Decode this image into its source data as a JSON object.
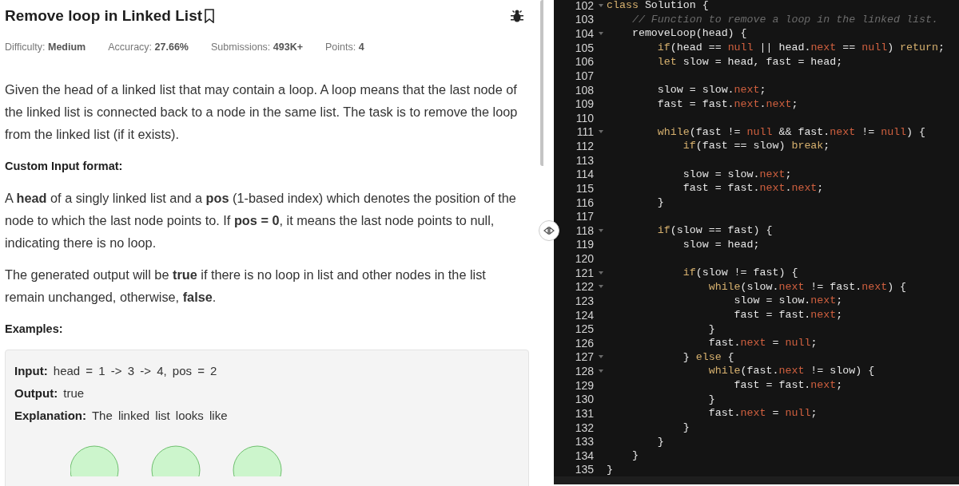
{
  "problem": {
    "title": "Remove loop in Linked List",
    "meta": [
      {
        "label": "Difficulty:",
        "value": "Medium"
      },
      {
        "label": "Accuracy:",
        "value": "27.66%"
      },
      {
        "label": "Submissions:",
        "value": "493K+"
      },
      {
        "label": "Points:",
        "value": "4"
      }
    ],
    "body": [
      {
        "kind": "paragraph",
        "text": "Given the head of a linked list that may contain a loop.  A loop means that the last node of the linked list is connected back to a node in the same list. The task is to remove the loop from the linked list (if it exists)."
      },
      {
        "kind": "heading",
        "text": "Custom Input format:"
      },
      {
        "kind": "paragraph",
        "text": "A **head** of a singly linked list and a **pos** (1-based index) which denotes the position of the node to which the last node points to. If **pos = 0**, it means the last node points to null, indicating there is no loop."
      },
      {
        "kind": "paragraph",
        "text": "The generated output will be **true** if there is no loop in list and other nodes in the list remain unchanged, otherwise, **false**."
      },
      {
        "kind": "heading",
        "text": "Examples:"
      }
    ],
    "example": [
      {
        "label": "Input:",
        "value": "head = 1 -> 3 -> 4, pos = 2"
      },
      {
        "label": "Output:",
        "value": "true"
      },
      {
        "label": "Explanation:",
        "value": "The linked list looks like"
      }
    ]
  },
  "editor": {
    "lines": [
      {
        "number": "102",
        "fold": true,
        "tokens": [
          {
            "kind": "kw",
            "text": "class"
          },
          {
            "kind": "plain",
            "text": " Solution {"
          }
        ]
      },
      {
        "number": "103",
        "fold": false,
        "tokens": [
          {
            "kind": "comment",
            "text": "    // Function to remove a loop in the linked list."
          }
        ]
      },
      {
        "number": "104",
        "fold": true,
        "tokens": [
          {
            "kind": "plain",
            "text": "    removeLoop(head) {"
          }
        ]
      },
      {
        "number": "105",
        "fold": false,
        "tokens": [
          {
            "kind": "kw",
            "text": "        if"
          },
          {
            "kind": "plain",
            "text": "(head == "
          },
          {
            "kind": "lit",
            "text": "null"
          },
          {
            "kind": "plain",
            "text": " || head."
          },
          {
            "kind": "lit",
            "text": "next"
          },
          {
            "kind": "plain",
            "text": " == "
          },
          {
            "kind": "lit",
            "text": "null"
          },
          {
            "kind": "plain",
            "text": ") "
          },
          {
            "kind": "kw",
            "text": "return"
          },
          {
            "kind": "plain",
            "text": ";"
          }
        ]
      },
      {
        "number": "106",
        "fold": false,
        "tokens": [
          {
            "kind": "kw",
            "text": "        let"
          },
          {
            "kind": "plain",
            "text": " slow = head, fast = head;"
          }
        ]
      },
      {
        "number": "107",
        "fold": false
      },
      {
        "number": "108",
        "fold": false,
        "tokens": [
          {
            "kind": "plain",
            "text": "        slow = slow."
          },
          {
            "kind": "lit",
            "text": "next"
          },
          {
            "kind": "plain",
            "text": ";"
          }
        ]
      },
      {
        "number": "109",
        "fold": false,
        "tokens": [
          {
            "kind": "plain",
            "text": "        fast = fast."
          },
          {
            "kind": "lit",
            "text": "next"
          },
          {
            "kind": "plain",
            "text": "."
          },
          {
            "kind": "lit",
            "text": "next"
          },
          {
            "kind": "plain",
            "text": ";"
          }
        ]
      },
      {
        "number": "110",
        "fold": false
      },
      {
        "number": "111",
        "fold": true,
        "tokens": [
          {
            "kind": "kw",
            "text": "        while"
          },
          {
            "kind": "plain",
            "text": "(fast != "
          },
          {
            "kind": "lit",
            "text": "null"
          },
          {
            "kind": "plain",
            "text": " && fast."
          },
          {
            "kind": "lit",
            "text": "next"
          },
          {
            "kind": "plain",
            "text": " != "
          },
          {
            "kind": "lit",
            "text": "null"
          },
          {
            "kind": "plain",
            "text": ") {"
          }
        ]
      },
      {
        "number": "112",
        "fold": false,
        "tokens": [
          {
            "kind": "kw",
            "text": "            if"
          },
          {
            "kind": "plain",
            "text": "(fast == slow) "
          },
          {
            "kind": "kw",
            "text": "break"
          },
          {
            "kind": "plain",
            "text": ";"
          }
        ]
      },
      {
        "number": "113",
        "fold": false
      },
      {
        "number": "114",
        "fold": false,
        "tokens": [
          {
            "kind": "plain",
            "text": "            slow = slow."
          },
          {
            "kind": "lit",
            "text": "next"
          },
          {
            "kind": "plain",
            "text": ";"
          }
        ]
      },
      {
        "number": "115",
        "fold": false,
        "tokens": [
          {
            "kind": "plain",
            "text": "            fast = fast."
          },
          {
            "kind": "lit",
            "text": "next"
          },
          {
            "kind": "plain",
            "text": "."
          },
          {
            "kind": "lit",
            "text": "next"
          },
          {
            "kind": "plain",
            "text": ";"
          }
        ]
      },
      {
        "number": "116",
        "fold": false,
        "tokens": [
          {
            "kind": "plain",
            "text": "        }"
          }
        ]
      },
      {
        "number": "117",
        "fold": false
      },
      {
        "number": "118",
        "fold": true,
        "tokens": [
          {
            "kind": "kw",
            "text": "        if"
          },
          {
            "kind": "plain",
            "text": "(slow == fast) {"
          }
        ]
      },
      {
        "number": "119",
        "fold": false,
        "tokens": [
          {
            "kind": "plain",
            "text": "            slow = head;"
          }
        ]
      },
      {
        "number": "120",
        "fold": false
      },
      {
        "number": "121",
        "fold": true,
        "tokens": [
          {
            "kind": "kw",
            "text": "            if"
          },
          {
            "kind": "plain",
            "text": "(slow != fast) {"
          }
        ]
      },
      {
        "number": "122",
        "fold": true,
        "tokens": [
          {
            "kind": "kw",
            "text": "                while"
          },
          {
            "kind": "plain",
            "text": "(slow."
          },
          {
            "kind": "lit",
            "text": "next"
          },
          {
            "kind": "plain",
            "text": " != fast."
          },
          {
            "kind": "lit",
            "text": "next"
          },
          {
            "kind": "plain",
            "text": ") {"
          }
        ]
      },
      {
        "number": "123",
        "fold": false,
        "tokens": [
          {
            "kind": "plain",
            "text": "                    slow = slow."
          },
          {
            "kind": "lit",
            "text": "next"
          },
          {
            "kind": "plain",
            "text": ";"
          }
        ]
      },
      {
        "number": "124",
        "fold": false,
        "tokens": [
          {
            "kind": "plain",
            "text": "                    fast = fast."
          },
          {
            "kind": "lit",
            "text": "next"
          },
          {
            "kind": "plain",
            "text": ";"
          }
        ]
      },
      {
        "number": "125",
        "fold": false,
        "tokens": [
          {
            "kind": "plain",
            "text": "                }"
          }
        ]
      },
      {
        "number": "126",
        "fold": false,
        "tokens": [
          {
            "kind": "plain",
            "text": "                fast."
          },
          {
            "kind": "lit",
            "text": "next"
          },
          {
            "kind": "plain",
            "text": " = "
          },
          {
            "kind": "lit",
            "text": "null"
          },
          {
            "kind": "plain",
            "text": ";"
          }
        ]
      },
      {
        "number": "127",
        "fold": true,
        "tokens": [
          {
            "kind": "plain",
            "text": "            } "
          },
          {
            "kind": "kw",
            "text": "else"
          },
          {
            "kind": "plain",
            "text": " {"
          }
        ]
      },
      {
        "number": "128",
        "fold": true,
        "tokens": [
          {
            "kind": "kw",
            "text": "                while"
          },
          {
            "kind": "plain",
            "text": "(fast."
          },
          {
            "kind": "lit",
            "text": "next"
          },
          {
            "kind": "plain",
            "text": " != slow) {"
          }
        ]
      },
      {
        "number": "129",
        "fold": false,
        "tokens": [
          {
            "kind": "plain",
            "text": "                    fast = fast."
          },
          {
            "kind": "lit",
            "text": "next"
          },
          {
            "kind": "plain",
            "text": ";"
          }
        ]
      },
      {
        "number": "130",
        "fold": false,
        "tokens": [
          {
            "kind": "plain",
            "text": "                }"
          }
        ]
      },
      {
        "number": "131",
        "fold": false,
        "tokens": [
          {
            "kind": "plain",
            "text": "                fast."
          },
          {
            "kind": "lit",
            "text": "next"
          },
          {
            "kind": "plain",
            "text": " = "
          },
          {
            "kind": "lit",
            "text": "null"
          },
          {
            "kind": "plain",
            "text": ";"
          }
        ]
      },
      {
        "number": "132",
        "fold": false,
        "tokens": [
          {
            "kind": "plain",
            "text": "            }"
          }
        ]
      },
      {
        "number": "133",
        "fold": false,
        "tokens": [
          {
            "kind": "plain",
            "text": "        }"
          }
        ]
      },
      {
        "number": "134",
        "fold": false,
        "tokens": [
          {
            "kind": "plain",
            "text": "    }"
          }
        ]
      },
      {
        "number": "135",
        "fold": false,
        "tokens": [
          {
            "kind": "plain",
            "text": "}"
          }
        ]
      }
    ]
  }
}
